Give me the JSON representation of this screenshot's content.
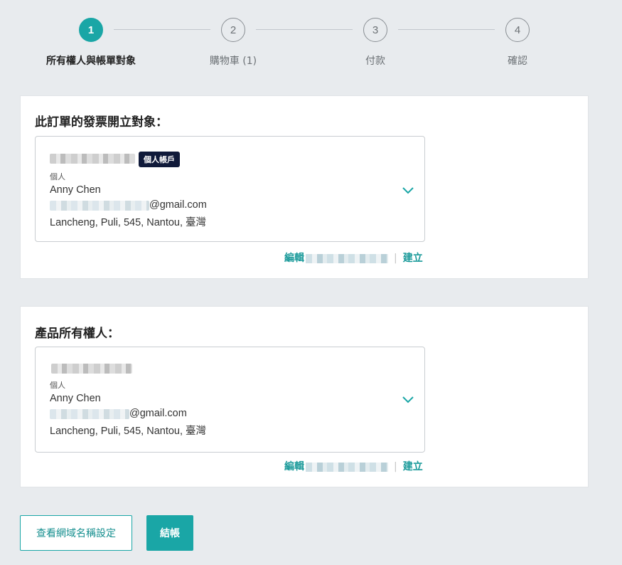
{
  "stepper": {
    "steps": [
      {
        "number": "1",
        "label": "所有權人與帳單對象"
      },
      {
        "number": "2",
        "label": "購物車 (1)"
      },
      {
        "number": "3",
        "label": "付款"
      },
      {
        "number": "4",
        "label": "確認"
      }
    ]
  },
  "billing": {
    "title": "此訂單的發票開立對象：",
    "badge": "個人帳戶",
    "type": "個人",
    "name": "Anny Chen",
    "email_suffix": "@gmail.com",
    "address": "Lancheng, Puli, 545, Nantou, 臺灣",
    "edit_label": "編輯",
    "create_label": "建立"
  },
  "owner": {
    "title": "產品所有權人：",
    "type": "個人",
    "name": "Anny Chen",
    "email_suffix": "@gmail.com",
    "address": "Lancheng, Puli, 545, Nantou, 臺灣",
    "edit_label": "編輯",
    "create_label": "建立"
  },
  "actions": {
    "view_domain_settings": "查看網域名稱設定",
    "checkout": "結帳"
  },
  "colors": {
    "accent": "#1aa6a6",
    "badge_bg": "#101a3a"
  }
}
